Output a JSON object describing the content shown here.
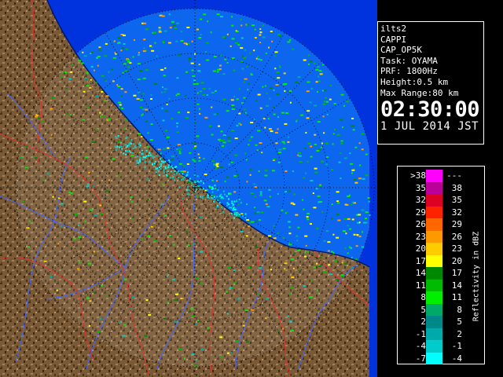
{
  "radar": {
    "station": "ilts2",
    "product": "CAPPI",
    "product_code": "CAP_OP5K",
    "task": "Task: OYAMA",
    "prf": "PRF: 1800Hz",
    "height": "Height:0.5 km",
    "max_range": "Max Range:80 km",
    "time": "02:30:00",
    "date": "1 JUL 2014 JST"
  },
  "legend": {
    "unit_label": "Reflectivity in dBZ",
    "rows": [
      {
        "left": ">38",
        "right": "---",
        "color": "#ff00ff"
      },
      {
        "left": "35",
        "right": "38",
        "color": "#bb0099"
      },
      {
        "left": "32",
        "right": "35",
        "color": "#dd0022"
      },
      {
        "left": "29",
        "right": "32",
        "color": "#ff2200"
      },
      {
        "left": "26",
        "right": "29",
        "color": "#ff6600"
      },
      {
        "left": "23",
        "right": "26",
        "color": "#ff9900"
      },
      {
        "left": "20",
        "right": "23",
        "color": "#ffcc00"
      },
      {
        "left": "17",
        "right": "20",
        "color": "#ffff00"
      },
      {
        "left": "14",
        "right": "17",
        "color": "#008800"
      },
      {
        "left": "11",
        "right": "14",
        "color": "#00bb00"
      },
      {
        "left": "8",
        "right": "11",
        "color": "#00ee00"
      },
      {
        "left": "5",
        "right": "8",
        "color": "#00aa66"
      },
      {
        "left": "2",
        "right": "5",
        "color": "#008888"
      },
      {
        "left": "-1",
        "right": "2",
        "color": "#00aaaa"
      },
      {
        "left": "-4",
        "right": "-1",
        "color": "#00cccc"
      },
      {
        "left": "-7",
        "right": "-4",
        "color": "#00ffff"
      }
    ]
  },
  "colors": {
    "sea": "#0033dd",
    "radar_sea": "#0d66ee",
    "land": "#7a5a36",
    "land_dark": "#3a2814",
    "rivers": "#4466ff",
    "boundaries": "#dd3333",
    "range_rings": "#000000"
  }
}
